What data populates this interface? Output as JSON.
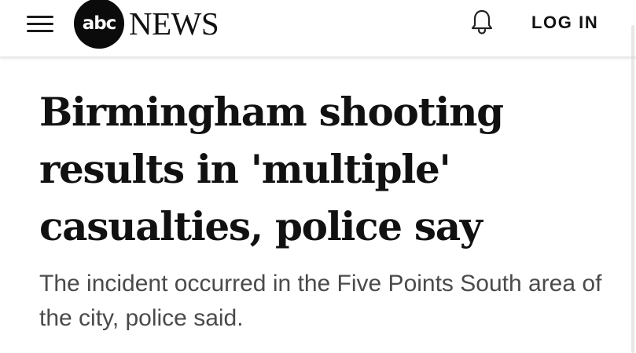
{
  "header": {
    "brand_badge": "abc",
    "brand_name": "NEWS",
    "login_label": "LOG IN",
    "icons": {
      "menu": "hamburger-icon",
      "notifications": "bell-icon"
    }
  },
  "article": {
    "headline": "Birmingham shooting results in 'multiple' casualties, police say",
    "summary": "The incident occurred in the Five Points South area of the city, police said."
  },
  "colors": {
    "text_primary": "#111111",
    "text_secondary": "#4a4a4a",
    "logo_circle": "#0b0b0b",
    "background": "#ffffff"
  }
}
